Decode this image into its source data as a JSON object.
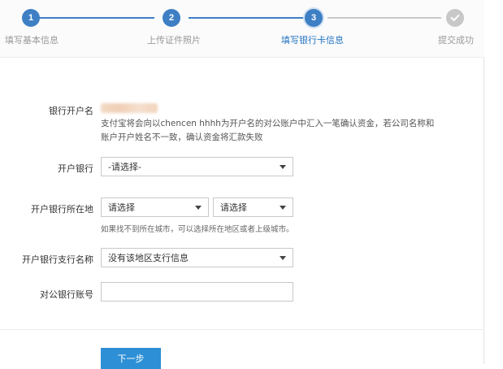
{
  "steps": [
    {
      "num": "1",
      "label": "填写基本信息",
      "state": "done"
    },
    {
      "num": "2",
      "label": "上传证件照片",
      "state": "done"
    },
    {
      "num": "3",
      "label": "填写银行卡信息",
      "state": "active"
    },
    {
      "num": "",
      "label": "提交成功",
      "state": "pending",
      "icon": "check-icon"
    }
  ],
  "colors": {
    "done": "#3e7fc4",
    "pending": "#c8c8c8",
    "active_text": "#2474c0",
    "button": "#2d8fd5"
  },
  "form": {
    "account_name": {
      "label": "银行开户名",
      "hint_line1": "支付宝将会向以chencen hhhh为开户名的对公账户中汇入一笔确认资金，若公司名称和",
      "hint_line2": "账户开户姓名不一致，确认资金将汇款失败"
    },
    "bank": {
      "label": "开户银行",
      "value": "-请选择-"
    },
    "location": {
      "label": "开户银行所在地",
      "province": "请选择",
      "city": "请选择",
      "hint": "如果找不到所在城市，可以选择所在地区或者上级城市。"
    },
    "branch": {
      "label": "开户银行支行名称",
      "value": "没有该地区支行信息"
    },
    "account_number": {
      "label": "对公银行账号",
      "value": ""
    }
  },
  "next_button": "下一步"
}
